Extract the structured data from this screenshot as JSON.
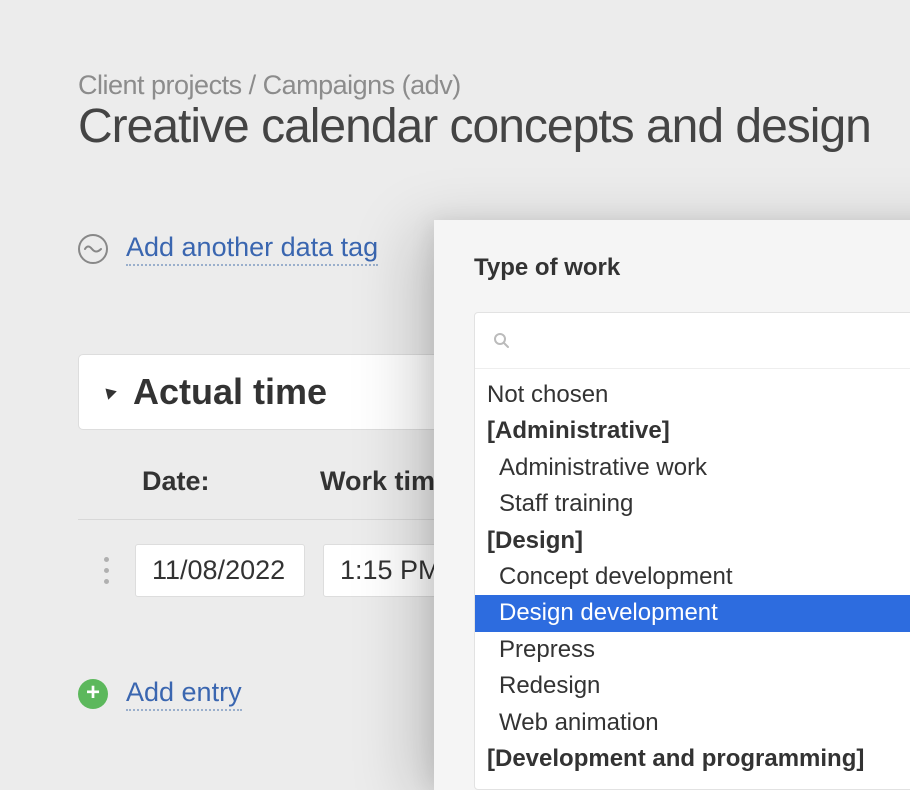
{
  "breadcrumb": {
    "path_1": "Client projects",
    "path_2": "Campaigns (adv)"
  },
  "page_title": "Creative calendar concepts and design",
  "tag_link": "Add another data tag",
  "section": {
    "title": "Actual time",
    "col_date": "Date:",
    "col_worktime": "Work time"
  },
  "entry": {
    "date": "11/08/2022",
    "time": "1:15 PM"
  },
  "add_entry": "Add entry",
  "dropdown": {
    "title": "Type of work",
    "search_placeholder": "",
    "not_chosen": "Not chosen",
    "groups": [
      {
        "label": "[Administrative]",
        "items": [
          "Administrative work",
          "Staff training"
        ]
      },
      {
        "label": "[Design]",
        "items": [
          "Concept development",
          "Design development",
          "Prepress",
          "Redesign",
          "Web animation"
        ]
      },
      {
        "label": "[Development and programming]",
        "items": []
      }
    ],
    "selected": "Design development"
  }
}
